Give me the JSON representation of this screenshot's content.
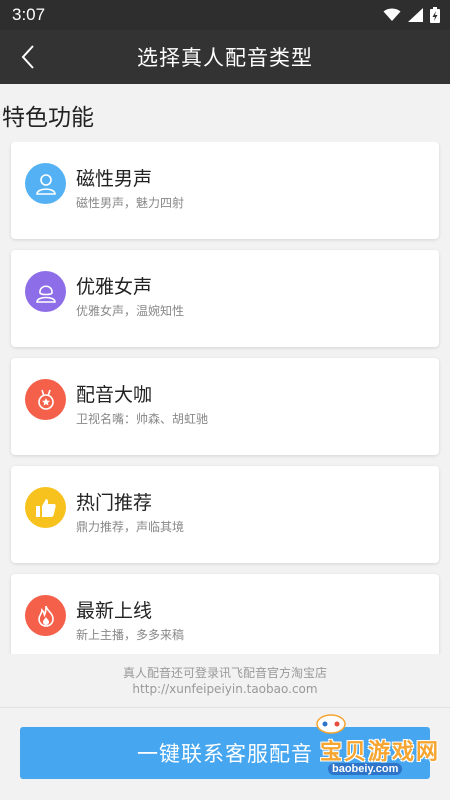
{
  "status_bar": {
    "time": "3:07"
  },
  "header": {
    "title": "选择真人配音类型"
  },
  "section_title": "特色功能",
  "cards": [
    {
      "name": "磁性男声",
      "desc": "磁性男声，魅力四射",
      "icon": "male-user-icon",
      "color": "#54b2f4"
    },
    {
      "name": "优雅女声",
      "desc": "优雅女声，温婉知性",
      "icon": "female-user-icon",
      "color": "#8e6ee8"
    },
    {
      "name": "配音大咖",
      "desc": "卫视名嘴：帅森、胡虹驰",
      "icon": "medal-icon",
      "color": "#f4604a"
    },
    {
      "name": "热门推荐",
      "desc": "鼎力推荐，声临其境",
      "icon": "thumbs-up-icon",
      "color": "#f7c21d"
    },
    {
      "name": "最新上线",
      "desc": "新上主播，多多来稿",
      "icon": "flame-icon",
      "color": "#f4604a"
    }
  ],
  "footer": {
    "line1": "真人配音还可登录讯飞配音官方淘宝店",
    "line2": "http://xunfeipeiyin.taobao.com"
  },
  "contact_button": {
    "label": "一键联系客服配音"
  },
  "watermark": {
    "text": "宝贝游戏网",
    "url": "baobeiy.com"
  },
  "colors": {
    "accent": "#46a6f0",
    "header": "#333333",
    "statusbar": "#2e2e2e",
    "background": "#f2f2f2"
  }
}
